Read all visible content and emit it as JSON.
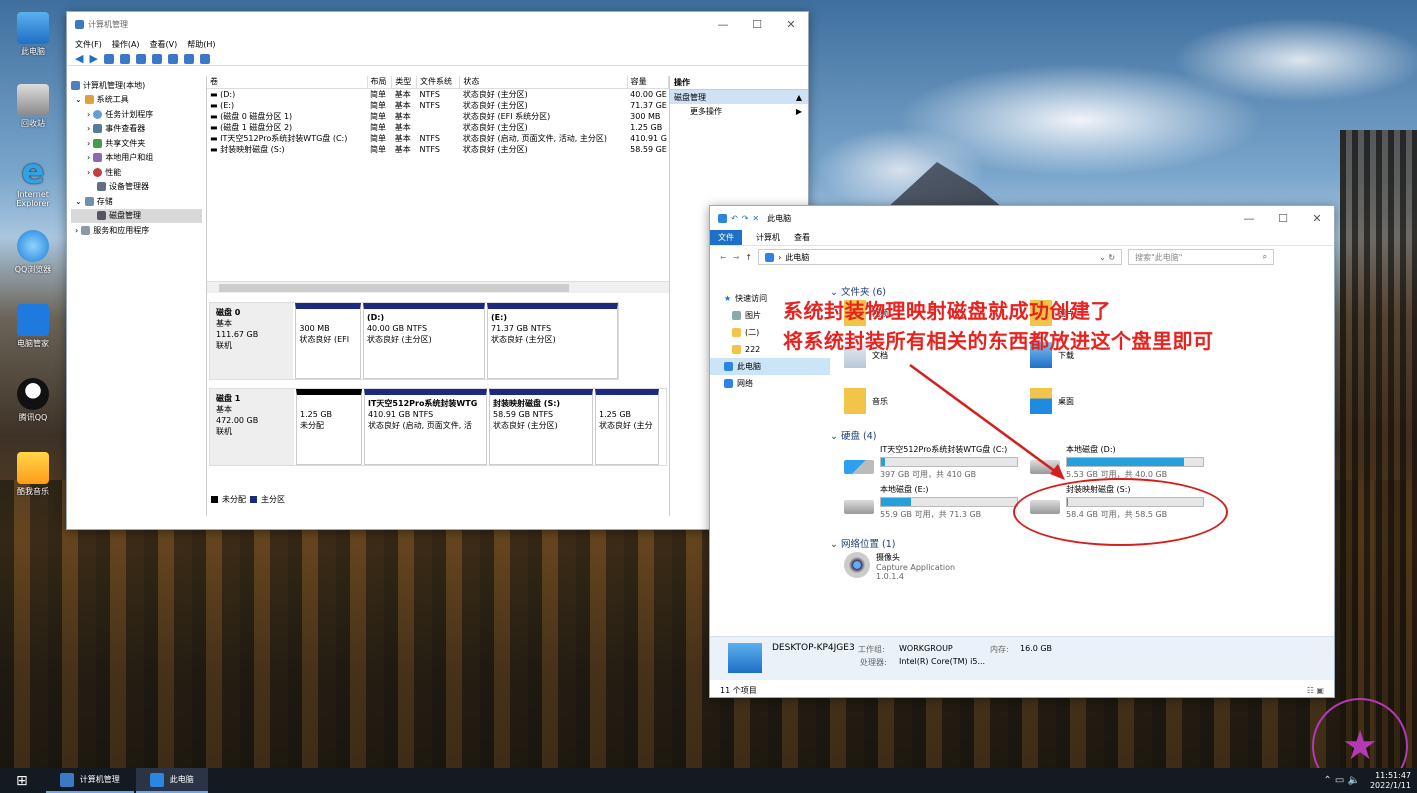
{
  "desktop": {
    "icons": [
      {
        "label": "此电脑"
      },
      {
        "label": "回收站"
      },
      {
        "label": "Internet Explorer"
      },
      {
        "label": "QQ浏览器"
      },
      {
        "label": "电脑管家"
      },
      {
        "label": "腾讯QQ"
      },
      {
        "label": "酷我音乐"
      }
    ]
  },
  "cm": {
    "title": "计算机管理",
    "menu": [
      "文件(F)",
      "操作(A)",
      "查看(V)",
      "帮助(H)"
    ],
    "tree": [
      {
        "label": "计算机管理(本地)"
      },
      {
        "label": "系统工具"
      },
      {
        "label": "任务计划程序"
      },
      {
        "label": "事件查看器"
      },
      {
        "label": "共享文件夹"
      },
      {
        "label": "本地用户和组"
      },
      {
        "label": "性能"
      },
      {
        "label": "设备管理器"
      },
      {
        "label": "存储"
      },
      {
        "label": "磁盘管理"
      },
      {
        "label": "服务和应用程序"
      }
    ],
    "columns": [
      "卷",
      "布局",
      "类型",
      "文件系统",
      "状态",
      "容量"
    ],
    "volumes": [
      [
        "(D:)",
        "简单",
        "基本",
        "NTFS",
        "状态良好 (主分区)",
        "40.00 GE"
      ],
      [
        "(E:)",
        "简单",
        "基本",
        "NTFS",
        "状态良好 (主分区)",
        "71.37 GE"
      ],
      [
        "(磁盘 0 磁盘分区 1)",
        "简单",
        "基本",
        "",
        "状态良好 (EFI 系统分区)",
        "300 MB"
      ],
      [
        "(磁盘 1 磁盘分区 2)",
        "简单",
        "基本",
        "",
        "状态良好 (主分区)",
        "1.25 GB"
      ],
      [
        "IT天空512Pro系统封装WTG盘 (C:)",
        "简单",
        "基本",
        "NTFS",
        "状态良好 (启动, 页面文件, 活动, 主分区)",
        "410.91 G"
      ],
      [
        "封装映射磁盘 (S:)",
        "简单",
        "基本",
        "NTFS",
        "状态良好 (主分区)",
        "58.59 GE"
      ]
    ],
    "disk0": {
      "name": "磁盘 0",
      "type": "基本",
      "size": "111.67 GB",
      "state": "联机",
      "parts": [
        {
          "l1": "",
          "l2": "300 MB",
          "l3": "状态良好 (EFI"
        },
        {
          "l1": "(D:)",
          "l2": "40.00 GB NTFS",
          "l3": "状态良好 (主分区)"
        },
        {
          "l1": "(E:)",
          "l2": "71.37 GB NTFS",
          "l3": "状态良好 (主分区)"
        }
      ]
    },
    "disk1": {
      "name": "磁盘 1",
      "type": "基本",
      "size": "472.00 GB",
      "state": "联机",
      "parts": [
        {
          "l1": "",
          "l2": "1.25 GB",
          "l3": "未分配"
        },
        {
          "l1": "IT天空512Pro系统封装WTG",
          "l2": "410.91 GB NTFS",
          "l3": "状态良好 (启动, 页面文件, 活"
        },
        {
          "l1": "封装映射磁盘 (S:)",
          "l2": "58.59 GB NTFS",
          "l3": "状态良好 (主分区)"
        },
        {
          "l1": "",
          "l2": "1.25 GB",
          "l3": "状态良好 (主分"
        }
      ]
    },
    "legend": {
      "unalloc": "未分配",
      "primary": "主分区"
    },
    "actions": {
      "header": "操作",
      "selected": "磁盘管理",
      "more": "更多操作"
    }
  },
  "ex": {
    "title": "此电脑",
    "ribbon": [
      "文件",
      "计算机",
      "查看"
    ],
    "address": "此电脑",
    "search": "搜索\"此电脑\"",
    "nav": [
      {
        "label": "快速访问"
      },
      {
        "label": "图片"
      },
      {
        "label": "(二)"
      },
      {
        "label": "222"
      },
      {
        "label": "此电脑"
      },
      {
        "label": "网络"
      }
    ],
    "groups": {
      "folders": "文件夹 (6)",
      "drives": "硬盘 (4)",
      "network": "网络位置 (1)"
    },
    "folders": [
      {
        "label": "视频"
      },
      {
        "label": "图片"
      },
      {
        "label": "文档"
      },
      {
        "label": "下载"
      },
      {
        "label": "音乐"
      },
      {
        "label": "桌面"
      }
    ],
    "drives": [
      {
        "name": "IT天空512Pro系统封装WTG盘 (C:)",
        "free": "397 GB 可用，共 410 GB",
        "used": 0.03
      },
      {
        "name": "本地磁盘 (D:)",
        "free": "5.53 GB 可用，共 40.0 GB",
        "used": 0.86
      },
      {
        "name": "本地磁盘 (E:)",
        "free": "55.9 GB 可用，共 71.3 GB",
        "used": 0.22
      },
      {
        "name": "封装映射磁盘 (S:)",
        "free": "58.4 GB 可用，共 58.5 GB",
        "used": 0.002
      }
    ],
    "netitem": {
      "name": "摄像头",
      "sub1": "Capture Application",
      "sub2": "1.0.1.4"
    },
    "detail": {
      "pc": "DESKTOP-KP4JGE3",
      "wg_label": "工作组:",
      "wg": "WORKGROUP",
      "mem_label": "内存:",
      "mem": "16.0 GB",
      "cpu_label": "处理器:",
      "cpu": "Intel(R) Core(TM) i5..."
    },
    "status": "11 个项目"
  },
  "annotation": {
    "line1": "系统封装物理映射磁盘就成功创建了",
    "line2": "将系统封装所有相关的东西都放进这个盘里即可"
  },
  "taskbar": {
    "items": [
      "计算机管理",
      "此电脑"
    ],
    "time": "11:51:47",
    "date": "2022/1/11"
  }
}
